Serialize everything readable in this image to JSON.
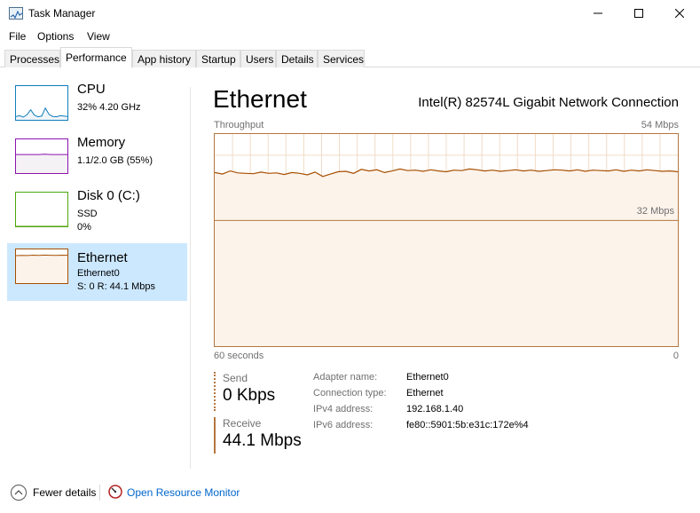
{
  "window": {
    "title": "Task Manager",
    "icons": {
      "app": "task-manager-icon",
      "minimize": "minimize-icon",
      "maximize": "maximize-icon",
      "close": "close-icon"
    }
  },
  "menu": [
    "File",
    "Options",
    "View"
  ],
  "tabs": [
    "Processes",
    "Performance",
    "App history",
    "Startup",
    "Users",
    "Details",
    "Services"
  ],
  "active_tab": "Performance",
  "sidebar": {
    "cpu": {
      "title": "CPU",
      "line1": "32%  4.20 GHz"
    },
    "memory": {
      "title": "Memory",
      "line1": "1.1/2.0 GB (55%)"
    },
    "disk": {
      "title": "Disk 0 (C:)",
      "line1": "SSD",
      "line2": "0%"
    },
    "ethernet": {
      "title": "Ethernet",
      "line1": "Ethernet0",
      "line2": "S: 0 R: 44.1 Mbps"
    }
  },
  "main": {
    "title": "Ethernet",
    "adapter": "Intel(R) 82574L Gigabit Network Connection",
    "throughput_label": "Throughput",
    "max_label": "54 Mbps",
    "mid_label": "32 Mbps",
    "time_label": "60 seconds",
    "zero_label": "0",
    "send_label": "Send",
    "send_value": "0 Kbps",
    "receive_label": "Receive",
    "receive_value": "44.1 Mbps",
    "props": [
      {
        "key": "Adapter name:",
        "value": "Ethernet0"
      },
      {
        "key": "Connection type:",
        "value": "Ethernet"
      },
      {
        "key": "IPv4 address:",
        "value": "192.168.1.40"
      },
      {
        "key": "IPv6 address:",
        "value": "fe80::5901:5b:e31c:172e%4"
      }
    ]
  },
  "footer": {
    "fewer_details": "Fewer details",
    "open_resource_monitor": "Open Resource Monitor",
    "icons": {
      "fewer": "chevron-up-circle-icon",
      "resource_monitor": "resource-monitor-icon"
    }
  },
  "colors": {
    "cpu": "#117dbb",
    "memory": "#8b12ae",
    "disk": "#4da60c",
    "ethernet": "#a74f01",
    "ethernet_fill": "#fcf3eb",
    "selected_bg": "#cce8ff",
    "link": "#0066cc"
  },
  "chart_data": {
    "type": "area",
    "ylabel": "Throughput",
    "ylim": [
      0,
      54
    ],
    "xlabel": "60 seconds",
    "reference_line": 32,
    "series": [
      {
        "values": [
          44.2,
          43.8,
          44.6,
          44.1,
          44.0,
          43.9,
          44.3,
          44.0,
          44.1,
          43.7,
          44.2,
          44.0,
          43.6,
          44.3,
          43.2,
          43.8,
          44.4,
          44.5,
          44.0,
          45.0,
          44.6,
          44.9,
          44.2,
          44.6,
          45.1,
          44.7,
          44.8,
          44.5,
          44.9,
          44.6,
          44.4,
          44.8,
          44.7,
          45.1,
          44.9,
          44.6,
          44.8,
          44.5,
          44.7,
          44.9,
          44.6,
          44.8,
          44.5,
          44.7,
          44.9,
          44.8,
          44.6,
          44.9,
          44.5,
          44.8,
          44.7,
          44.6,
          44.9,
          44.5,
          44.8,
          44.6,
          44.9,
          44.7,
          44.5,
          44.6,
          44.4
        ]
      }
    ]
  },
  "thumb_data": {
    "cpu": [
      10,
      12,
      8,
      15,
      30,
      14,
      9,
      11,
      35,
      16,
      10,
      9,
      12,
      11,
      10
    ],
    "memory": [
      55,
      55,
      55,
      55,
      55,
      56,
      55,
      55,
      55,
      55
    ],
    "disk": [
      0,
      0,
      0,
      0,
      0,
      0,
      0,
      0,
      0,
      0
    ],
    "ethernet": [
      44,
      44.5,
      44.2,
      44.8,
      44.4,
      44.9,
      44.6,
      44.3,
      44.8,
      44.6
    ]
  }
}
